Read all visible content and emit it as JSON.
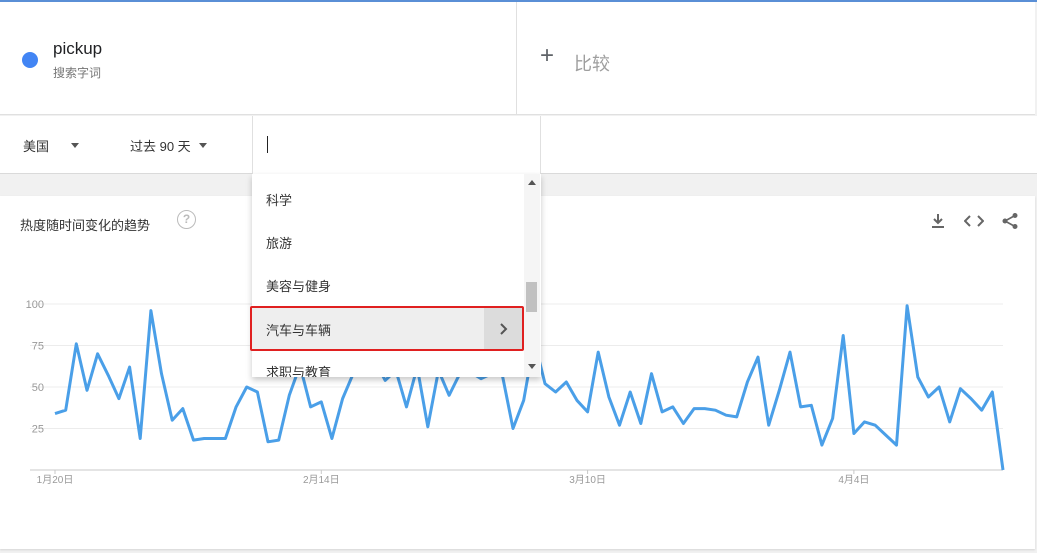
{
  "term": {
    "name": "pickup",
    "type": "搜索字词",
    "color": "#4285f4"
  },
  "compare": {
    "icon": "plus-icon",
    "label": "比较"
  },
  "filters": {
    "region": "美国",
    "time_range": "过去 90 天",
    "category_input": ""
  },
  "card": {
    "title": "热度随时间变化的趋势",
    "help_icon": "?",
    "actions": [
      "download-icon",
      "embed-code-icon",
      "share-icon"
    ]
  },
  "dropdown": {
    "items": [
      {
        "label": "科学",
        "has_submenu": false,
        "active": false
      },
      {
        "label": "旅游",
        "has_submenu": false,
        "active": false
      },
      {
        "label": "美容与健身",
        "has_submenu": false,
        "active": false
      },
      {
        "label": "汽车与车辆",
        "has_submenu": true,
        "active": true
      },
      {
        "label": "求职与教育",
        "has_submenu": false,
        "active": false
      }
    ]
  },
  "chart_data": {
    "type": "line",
    "title": "",
    "xlabel": "",
    "ylabel": "",
    "ylim": [
      0,
      100
    ],
    "yticks": [
      25,
      50,
      75,
      100
    ],
    "xticks": [
      {
        "label": "1月20日",
        "index": 0
      },
      {
        "label": "2月14日",
        "index": 25
      },
      {
        "label": "3月10日",
        "index": 50
      },
      {
        "label": "4月4日",
        "index": 75
      }
    ],
    "grid": true,
    "color": "#4a9fe8",
    "series": [
      {
        "values": [
          34,
          36,
          76,
          48,
          70,
          57,
          43,
          62,
          19,
          96,
          58,
          30,
          37,
          18,
          19,
          19,
          19,
          38,
          50,
          47,
          17,
          18,
          45,
          63,
          38,
          41,
          19,
          43,
          58,
          72,
          66,
          54,
          60,
          38,
          62,
          26,
          60,
          45,
          58,
          59,
          55,
          58,
          57,
          25,
          42,
          78,
          52,
          47,
          53,
          42,
          35,
          71,
          44,
          27,
          47,
          28,
          58,
          35,
          38,
          28,
          37,
          37,
          36,
          33,
          32,
          53,
          68,
          27,
          48,
          71,
          38,
          39,
          15,
          31,
          81,
          22,
          29,
          27,
          21,
          15,
          99,
          56,
          44,
          50,
          29,
          49,
          43,
          36,
          47,
          0
        ]
      }
    ]
  }
}
